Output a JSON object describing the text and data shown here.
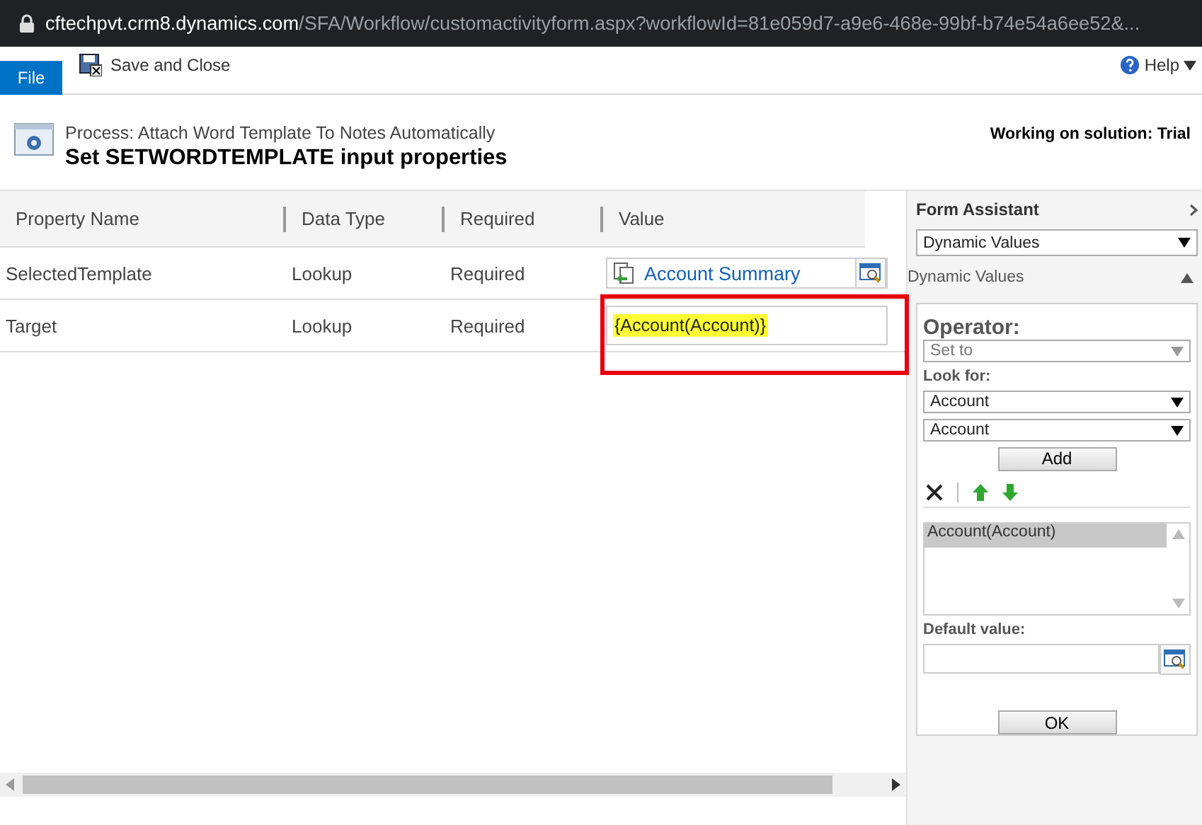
{
  "address_bar": {
    "host": "cftechpvt.crm8.dynamics.com",
    "path": "/SFA/Workflow/customactivityform.aspx?workflowId=81e059d7-a9e6-468e-99bf-b74e54a6ee52&..."
  },
  "ribbon": {
    "file_tab": "File",
    "save_button": "Save and Close",
    "help": "Help"
  },
  "header": {
    "process": "Process: Attach Word Template To Notes Automatically",
    "title": "Set SETWORDTEMPLATE input properties",
    "solution": "Working on solution: Trial"
  },
  "table": {
    "columns": [
      "Property Name",
      "Data Type",
      "Required",
      "Value"
    ],
    "rows": [
      {
        "name": "SelectedTemplate",
        "data_type": "Lookup",
        "required": "Required",
        "value": "Account Summary",
        "kind": "lookup",
        "highlighted": false
      },
      {
        "name": "Target",
        "data_type": "Lookup",
        "required": "Required",
        "value": "{Account(Account)}",
        "kind": "dynamic",
        "highlighted": true
      }
    ]
  },
  "form_assistant": {
    "title": "Form Assistant",
    "selector": "Dynamic Values",
    "section": "Dynamic Values",
    "expanded": true,
    "operator_label": "Operator:",
    "operator": "Set to",
    "operator_disabled": true,
    "look_for_label": "Look for:",
    "look_for": [
      "Account",
      "Account"
    ],
    "add_button": "Add",
    "list": [
      {
        "label": "Account(Account)",
        "selected": true
      }
    ],
    "default_label": "Default value:",
    "ok_button": "OK"
  }
}
